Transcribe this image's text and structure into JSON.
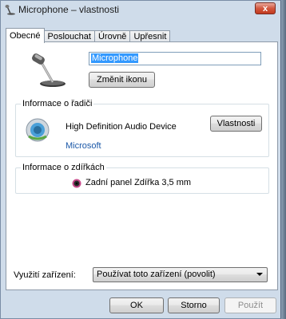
{
  "window": {
    "title": "Microphone – vlastnosti",
    "close_label": "x"
  },
  "tabs": [
    {
      "label": "Obecné"
    },
    {
      "label": "Poslouchat"
    },
    {
      "label": "Úrovně"
    },
    {
      "label": "Upřesnit"
    }
  ],
  "general": {
    "device_name": "Microphone",
    "change_icon_label": "Změnit ikonu"
  },
  "controller": {
    "group_label": "Informace o řadiči",
    "name": "High Definition Audio Device",
    "properties_label": "Vlastnosti",
    "vendor": "Microsoft"
  },
  "jack": {
    "group_label": "Informace o zdířkách",
    "description": "Zadní panel Zdířka 3,5 mm"
  },
  "usage": {
    "label": "Využití zařízení:",
    "selected": "Používat toto zařízení (povolit)"
  },
  "buttons": {
    "ok": "OK",
    "cancel": "Storno",
    "apply": "Použít"
  }
}
